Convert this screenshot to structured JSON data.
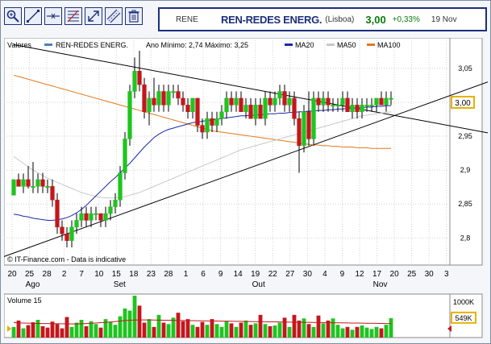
{
  "toolbar": {
    "buttons": [
      {
        "name": "zoom-button",
        "icon": "zoom-icon"
      },
      {
        "name": "draw-line-button",
        "icon": "trendline-icon"
      },
      {
        "name": "horizontal-line-button",
        "icon": "horizontal-line-icon"
      },
      {
        "name": "fibonacci-button",
        "icon": "fibonacci-icon"
      },
      {
        "name": "arrow-up-button",
        "icon": "arrow-diagonal-icon"
      },
      {
        "name": "parallel-lines-button",
        "icon": "parallel-lines-icon"
      },
      {
        "name": "delete-button",
        "icon": "trash-icon"
      }
    ]
  },
  "quote": {
    "ticker": "RENE",
    "name": "REN-REDES ENERG.",
    "market": "(Lisboa)",
    "price": "3,00",
    "change": "+0,33%",
    "date": "19 Nov"
  },
  "legend": {
    "values_label": "Valores",
    "series_name": "REN-REDES ENERG.",
    "range_text": "Ano Mínimo: 2,74 Máximo: 3,25",
    "ma20": "MA20",
    "ma50": "MA50",
    "ma100": "MA100"
  },
  "watermark": "© IT-Finance.com - Data is indicative",
  "colors": {
    "up": "#1fc41f",
    "down": "#c4161c",
    "series": "#4a7fc1",
    "ma20": "#1c2aa8",
    "ma50": "#c8c8c8",
    "ma100": "#e07a1c",
    "trendline": "#000000",
    "accent": "#1d2f7a"
  },
  "chart_data": [
    {
      "type": "candlestick",
      "yticks": [
        "3,05",
        "3,00",
        "2,95",
        "2,9",
        "2,85",
        "2,8"
      ],
      "ylim": [
        2.76,
        3.095
      ],
      "last_price_label": "3,00",
      "xticks": [
        "20",
        "25",
        "28",
        "2",
        "7",
        "10",
        "15",
        "18",
        "23",
        "28",
        "1",
        "6",
        "9",
        "14",
        "19",
        "22",
        "27",
        "30",
        "4",
        "9",
        "12",
        "17",
        "20",
        "25",
        "30",
        "3"
      ],
      "months": [
        "Ago",
        "Set",
        "Out",
        "Nov"
      ],
      "candles": [
        [
          2.863,
          2.886,
          2.863,
          2.886
        ],
        [
          2.886,
          2.895,
          2.876,
          2.876
        ],
        [
          2.876,
          2.895,
          2.866,
          2.886
        ],
        [
          2.886,
          2.906,
          2.873,
          2.876
        ],
        [
          2.876,
          2.912,
          2.866,
          2.876
        ],
        [
          2.876,
          2.895,
          2.866,
          2.886
        ],
        [
          2.886,
          2.896,
          2.866,
          2.876
        ],
        [
          2.876,
          2.886,
          2.866,
          2.876
        ],
        [
          2.876,
          2.886,
          2.846,
          2.856
        ],
        [
          2.856,
          2.866,
          2.806,
          2.816
        ],
        [
          2.816,
          2.826,
          2.796,
          2.806
        ],
        [
          2.806,
          2.816,
          2.786,
          2.796
        ],
        [
          2.796,
          2.826,
          2.786,
          2.816
        ],
        [
          2.816,
          2.836,
          2.806,
          2.826
        ],
        [
          2.826,
          2.846,
          2.816,
          2.836
        ],
        [
          2.836,
          2.846,
          2.816,
          2.826
        ],
        [
          2.826,
          2.846,
          2.816,
          2.836
        ],
        [
          2.836,
          2.846,
          2.826,
          2.836
        ],
        [
          2.836,
          2.836,
          2.816,
          2.826
        ],
        [
          2.826,
          2.846,
          2.816,
          2.836
        ],
        [
          2.836,
          2.856,
          2.826,
          2.846
        ],
        [
          2.846,
          2.866,
          2.836,
          2.856
        ],
        [
          2.856,
          2.906,
          2.846,
          2.896
        ],
        [
          2.896,
          2.956,
          2.886,
          2.946
        ],
        [
          2.946,
          3.026,
          2.936,
          3.016
        ],
        [
          3.016,
          3.066,
          3.006,
          3.046
        ],
        [
          3.046,
          3.076,
          3.016,
          3.026
        ],
        [
          3.026,
          3.036,
          2.976,
          2.986
        ],
        [
          2.986,
          3.016,
          2.966,
          3.006
        ],
        [
          3.006,
          3.036,
          2.986,
          2.996
        ],
        [
          2.996,
          3.026,
          2.986,
          3.016
        ],
        [
          3.016,
          3.026,
          2.986,
          2.996
        ],
        [
          2.996,
          3.026,
          2.986,
          3.016
        ],
        [
          3.016,
          3.026,
          3.006,
          3.016
        ],
        [
          3.016,
          3.026,
          2.996,
          3.006
        ],
        [
          3.006,
          3.016,
          2.986,
          2.996
        ],
        [
          2.996,
          3.006,
          2.976,
          2.986
        ],
        [
          2.986,
          3.006,
          2.976,
          3.006
        ],
        [
          3.006,
          3.006,
          2.956,
          2.966
        ],
        [
          2.966,
          2.976,
          2.946,
          2.956
        ],
        [
          2.956,
          2.986,
          2.946,
          2.976
        ],
        [
          2.976,
          2.986,
          2.956,
          2.966
        ],
        [
          2.966,
          2.986,
          2.956,
          2.976
        ],
        [
          2.976,
          2.996,
          2.966,
          2.986
        ],
        [
          2.986,
          3.016,
          2.976,
          3.006
        ],
        [
          3.006,
          3.016,
          2.986,
          2.996
        ],
        [
          2.996,
          3.016,
          2.986,
          3.006
        ],
        [
          3.006,
          3.016,
          2.986,
          2.986
        ],
        [
          2.986,
          3.006,
          2.976,
          2.996
        ],
        [
          2.996,
          3.006,
          2.976,
          2.976
        ],
        [
          2.976,
          3.006,
          2.966,
          2.996
        ],
        [
          2.996,
          3.006,
          2.976,
          2.976
        ],
        [
          2.976,
          3.016,
          2.966,
          3.006
        ],
        [
          3.006,
          3.016,
          2.986,
          2.996
        ],
        [
          2.996,
          3.016,
          2.986,
          3.006
        ],
        [
          3.006,
          3.026,
          2.996,
          3.016
        ],
        [
          3.016,
          3.026,
          2.986,
          2.996
        ],
        [
          2.996,
          3.016,
          2.986,
          3.006
        ],
        [
          3.006,
          3.016,
          2.966,
          2.976
        ],
        [
          2.976,
          2.986,
          2.896,
          2.936
        ],
        [
          2.936,
          2.996,
          2.926,
          2.986
        ],
        [
          2.986,
          3.016,
          2.936,
          2.946
        ],
        [
          2.946,
          3.016,
          2.936,
          3.006
        ],
        [
          3.006,
          3.016,
          2.986,
          2.996
        ],
        [
          2.996,
          3.016,
          2.986,
          3.006
        ],
        [
          3.006,
          3.016,
          2.986,
          2.996
        ],
        [
          2.996,
          3.006,
          2.986,
          2.996
        ],
        [
          2.996,
          3.006,
          2.986,
          2.996
        ],
        [
          2.996,
          3.016,
          2.986,
          3.006
        ],
        [
          3.006,
          3.016,
          2.986,
          2.986
        ],
        [
          2.986,
          3.006,
          2.976,
          2.996
        ],
        [
          2.996,
          3.006,
          2.976,
          2.986
        ],
        [
          2.986,
          3.006,
          2.976,
          2.996
        ],
        [
          2.996,
          3.006,
          2.986,
          2.996
        ],
        [
          2.996,
          3.006,
          2.986,
          2.996
        ],
        [
          2.996,
          3.006,
          2.986,
          3.006
        ],
        [
          3.006,
          3.016,
          2.996,
          2.996
        ],
        [
          2.996,
          3.016,
          2.986,
          3.006
        ],
        [
          3.006,
          3.016,
          2.996,
          3.006
        ]
      ],
      "ma20": [
        2.835,
        2.834,
        2.832,
        2.831,
        2.829,
        2.828,
        2.827,
        2.826,
        2.826,
        2.827,
        2.828,
        2.83,
        2.833,
        2.837,
        2.842,
        2.848,
        2.855,
        2.862,
        2.869,
        2.876,
        2.883,
        2.889,
        2.896,
        2.903,
        2.91,
        2.918,
        2.926,
        2.934,
        2.941,
        2.948,
        2.953,
        2.957,
        2.96,
        2.962,
        2.964,
        2.966,
        2.968,
        2.97,
        2.971,
        2.972,
        2.973,
        2.974,
        2.975,
        2.976,
        2.977,
        2.978,
        2.979,
        2.98,
        2.98,
        2.981,
        2.981,
        2.982,
        2.982,
        2.983,
        2.983,
        2.984,
        2.984,
        2.985,
        2.985,
        2.986,
        2.986,
        2.987,
        2.987,
        2.988,
        2.988,
        2.989,
        2.989,
        2.99,
        2.99,
        2.991,
        2.991,
        2.992,
        2.992,
        2.993,
        2.993,
        2.994,
        2.994,
        2.995,
        2.995
      ],
      "ma50": [
        2.92,
        2.915,
        2.91,
        2.905,
        2.9,
        2.896,
        2.892,
        2.888,
        2.885,
        2.882,
        2.879,
        2.876,
        2.873,
        2.87,
        2.867,
        2.865,
        2.863,
        2.861,
        2.86,
        2.859,
        2.859,
        2.859,
        2.86,
        2.861,
        2.863,
        2.865,
        2.867,
        2.87,
        2.873,
        2.876,
        2.879,
        2.882,
        2.885,
        2.888,
        2.891,
        2.894,
        2.897,
        2.9,
        2.903,
        2.906,
        2.909,
        2.912,
        2.915,
        2.918,
        2.921,
        2.924,
        2.927,
        2.93,
        2.932,
        2.934,
        2.936,
        2.938,
        2.94,
        2.942,
        2.944,
        2.946,
        2.948,
        2.95,
        2.952,
        2.954,
        2.956,
        2.958,
        2.96,
        2.962,
        2.964,
        2.966,
        2.968,
        2.97,
        2.972,
        2.974,
        2.976,
        2.978,
        2.98,
        2.981,
        2.982,
        2.983,
        2.984,
        2.985,
        2.986
      ],
      "ma100": [
        3.04,
        3.038,
        3.036,
        3.034,
        3.032,
        3.03,
        3.028,
        3.026,
        3.024,
        3.022,
        3.02,
        3.018,
        3.016,
        3.014,
        3.012,
        3.01,
        3.008,
        3.006,
        3.004,
        3.002,
        3.0,
        2.998,
        2.996,
        2.994,
        2.992,
        2.99,
        2.988,
        2.986,
        2.984,
        2.982,
        2.98,
        2.978,
        2.976,
        2.974,
        2.972,
        2.97,
        2.968,
        2.966,
        2.964,
        2.962,
        2.96,
        2.958,
        2.957,
        2.956,
        2.955,
        2.954,
        2.953,
        2.952,
        2.951,
        2.95,
        2.949,
        2.948,
        2.947,
        2.946,
        2.945,
        2.944,
        2.943,
        2.942,
        2.941,
        2.94,
        2.939,
        2.938,
        2.937,
        2.937,
        2.936,
        2.936,
        2.935,
        2.935,
        2.934,
        2.934,
        2.934,
        2.933,
        2.933,
        2.933,
        2.932,
        2.932,
        2.932,
        2.932,
        2.932
      ],
      "trendlines": [
        {
          "from": [
            0,
            3.085
          ],
          "to": [
            98,
            2.955
          ]
        },
        {
          "from": [
            -3,
            2.77
          ],
          "to": [
            98,
            3.03
          ]
        }
      ]
    },
    {
      "type": "bar",
      "title": "Volume 15",
      "yticks": [
        "1000K",
        "549K"
      ],
      "ylim": [
        0,
        1000
      ],
      "last_value_label": "549K",
      "values": [
        300,
        480,
        260,
        350,
        430,
        500,
        320,
        280,
        450,
        380,
        260,
        580,
        300,
        420,
        500,
        320,
        460,
        380,
        280,
        520,
        440,
        360,
        600,
        820,
        760,
        1300,
        900,
        420,
        520,
        300,
        640,
        420,
        380,
        560,
        700,
        460,
        520,
        360,
        300,
        440,
        360,
        520,
        380,
        300,
        460,
        400,
        300,
        420,
        480,
        360,
        400,
        640,
        380,
        320,
        340,
        420,
        560,
        300,
        640,
        480,
        540,
        380,
        300,
        620,
        400,
        480,
        540,
        360,
        260,
        300,
        220,
        300,
        340,
        280,
        240,
        300,
        260,
        360,
        549
      ],
      "directions": [
        "u",
        "d",
        "u",
        "d",
        "d",
        "u",
        "d",
        "d",
        "d",
        "d",
        "d",
        "d",
        "u",
        "u",
        "u",
        "d",
        "u",
        "u",
        "d",
        "u",
        "u",
        "u",
        "u",
        "u",
        "u",
        "u",
        "d",
        "d",
        "u",
        "d",
        "u",
        "d",
        "u",
        "u",
        "d",
        "d",
        "d",
        "u",
        "d",
        "d",
        "u",
        "d",
        "u",
        "u",
        "u",
        "d",
        "u",
        "d",
        "u",
        "d",
        "u",
        "d",
        "u",
        "d",
        "u",
        "u",
        "d",
        "u",
        "d",
        "d",
        "u",
        "d",
        "u",
        "d",
        "u",
        "d",
        "u",
        "u",
        "u",
        "d",
        "u",
        "d",
        "u",
        "u",
        "u",
        "u",
        "d",
        "u",
        "u"
      ],
      "ma": [
        420,
        415,
        410,
        405,
        400,
        398,
        396,
        394,
        392,
        390,
        388,
        386,
        384,
        386,
        390,
        396,
        402,
        410,
        420,
        430,
        440,
        452,
        465,
        480,
        490,
        495,
        498,
        498,
        497,
        495,
        492,
        490,
        488,
        485,
        482,
        480,
        478,
        476,
        474,
        472,
        470,
        468,
        466,
        464,
        462,
        460,
        458,
        456,
        454,
        452,
        450,
        448,
        446,
        444,
        442,
        440,
        438,
        436,
        434,
        432,
        430,
        428,
        426,
        424,
        422,
        420,
        418,
        416,
        414,
        412,
        410,
        408,
        406,
        404,
        402,
        400,
        398,
        396,
        395
      ]
    }
  ]
}
